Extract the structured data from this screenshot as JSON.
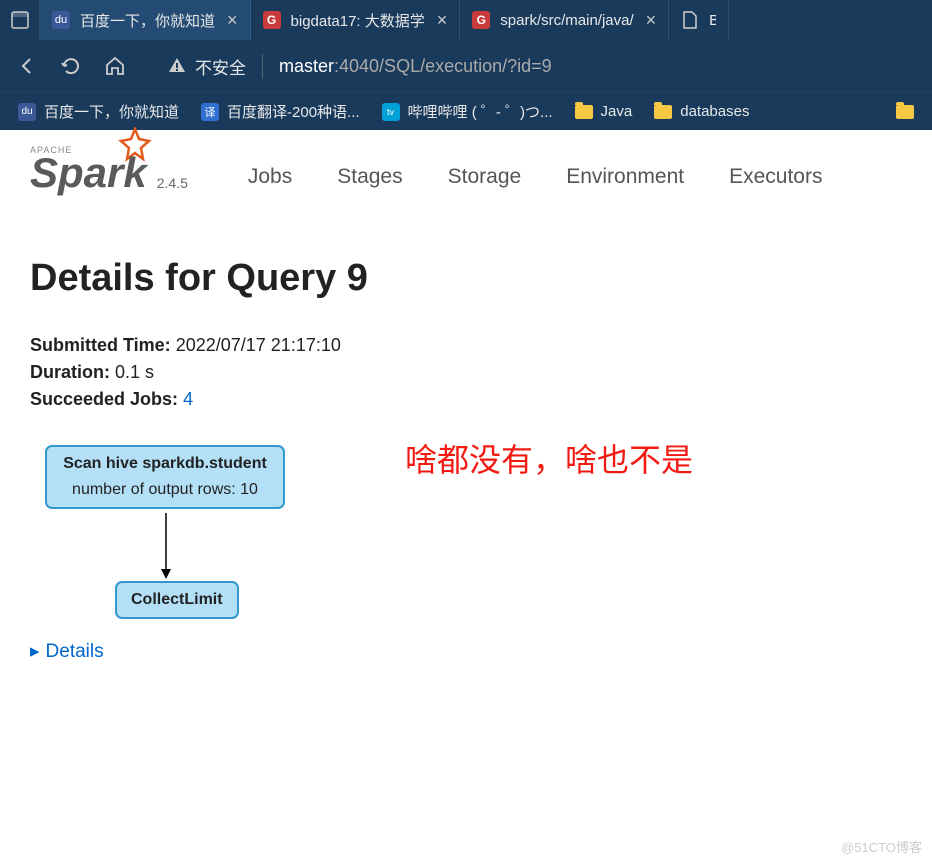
{
  "browser": {
    "tabs": [
      {
        "title": "百度一下，你就知道",
        "favicon_bg": "#3b5998"
      },
      {
        "title": "bigdata17: 大数据学",
        "favicon_bg": "#c93a3a"
      },
      {
        "title": "spark/src/main/java/",
        "favicon_bg": "#c93a3a"
      },
      {
        "title": "B",
        "favicon_bg": "#fff"
      }
    ],
    "security_label": "不安全",
    "url_host": "master",
    "url_path": ":4040/SQL/execution/?id=9",
    "bookmarks": [
      {
        "label": "百度一下，你就知道",
        "icon_bg": "#3b5998",
        "type": "site"
      },
      {
        "label": "百度翻译-200种语...",
        "icon_bg": "#3070d0",
        "type": "translate"
      },
      {
        "label": "哔哩哔哩 ( ゜- ゜)つ...",
        "icon_bg": "#00a1d6",
        "type": "site"
      },
      {
        "label": "Java",
        "type": "folder"
      },
      {
        "label": "databases",
        "type": "folder"
      }
    ]
  },
  "spark": {
    "logo_text": "Spark",
    "logo_prefix": "APACHE",
    "version": "2.4.5",
    "nav": [
      "Jobs",
      "Stages",
      "Storage",
      "Environment",
      "Executors"
    ],
    "page_title": "Details for Query 9",
    "details": {
      "submitted_label": "Submitted Time:",
      "submitted_value": "2022/07/17 21:17:10",
      "duration_label": "Duration:",
      "duration_value": "0.1 s",
      "succeeded_label": "Succeeded Jobs:",
      "succeeded_value": "4"
    },
    "dag": {
      "node1_title": "Scan hive sparkdb.student",
      "node1_detail": "number of output rows: 10",
      "node2_title": "CollectLimit"
    },
    "details_toggle": "Details",
    "annotation": "啥都没有，啥也不是"
  },
  "watermark": "@51CTO博客"
}
